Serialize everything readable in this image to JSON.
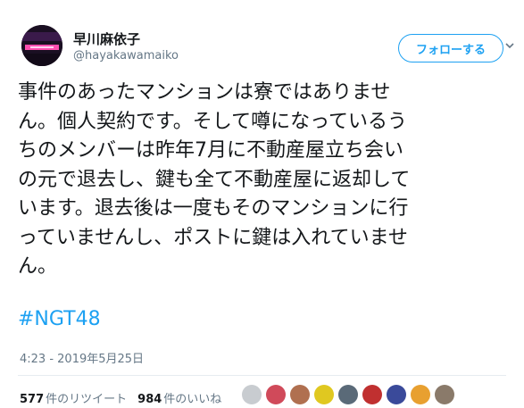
{
  "user": {
    "display_name": "早川麻依子",
    "handle": "@hayakawamaiko"
  },
  "follow_button": {
    "label": "フォローする"
  },
  "tweet": {
    "text": "事件のあったマンションは寮ではありませ\nん。個人契約です。そして噂になっているう\nちのメンバーは昨年7月に不動産屋立ち会い\nの元で退去し、鍵も全て不動産屋に返却して\nいます。退去後は一度もそのマンションに行\nっていませんし、ポストに鍵は入れていませ\nん。",
    "hashtag": "#NGT48",
    "timestamp": "4:23 - 2019年5月25日"
  },
  "stats": {
    "retweets_count": "577",
    "retweets_label": "件のリツイート",
    "likes_count": "984",
    "likes_label": "件のいいね"
  },
  "likers": [
    {
      "icon": "liker-avatar-1",
      "color": "#c8ccd0"
    },
    {
      "icon": "liker-avatar-2",
      "color": "#d04a5a"
    },
    {
      "icon": "liker-avatar-3",
      "color": "#b07050"
    },
    {
      "icon": "liker-avatar-4",
      "color": "#e0c820"
    },
    {
      "icon": "liker-avatar-5",
      "color": "#5a6a78"
    },
    {
      "icon": "liker-avatar-6",
      "color": "#c03030"
    },
    {
      "icon": "liker-avatar-7",
      "color": "#3a4a9a"
    },
    {
      "icon": "liker-avatar-8",
      "color": "#e8a030"
    },
    {
      "icon": "liker-avatar-9",
      "color": "#8a7a6a"
    }
  ],
  "colors": {
    "accent": "#1da1f2",
    "text": "#14171a",
    "muted": "#657786"
  }
}
